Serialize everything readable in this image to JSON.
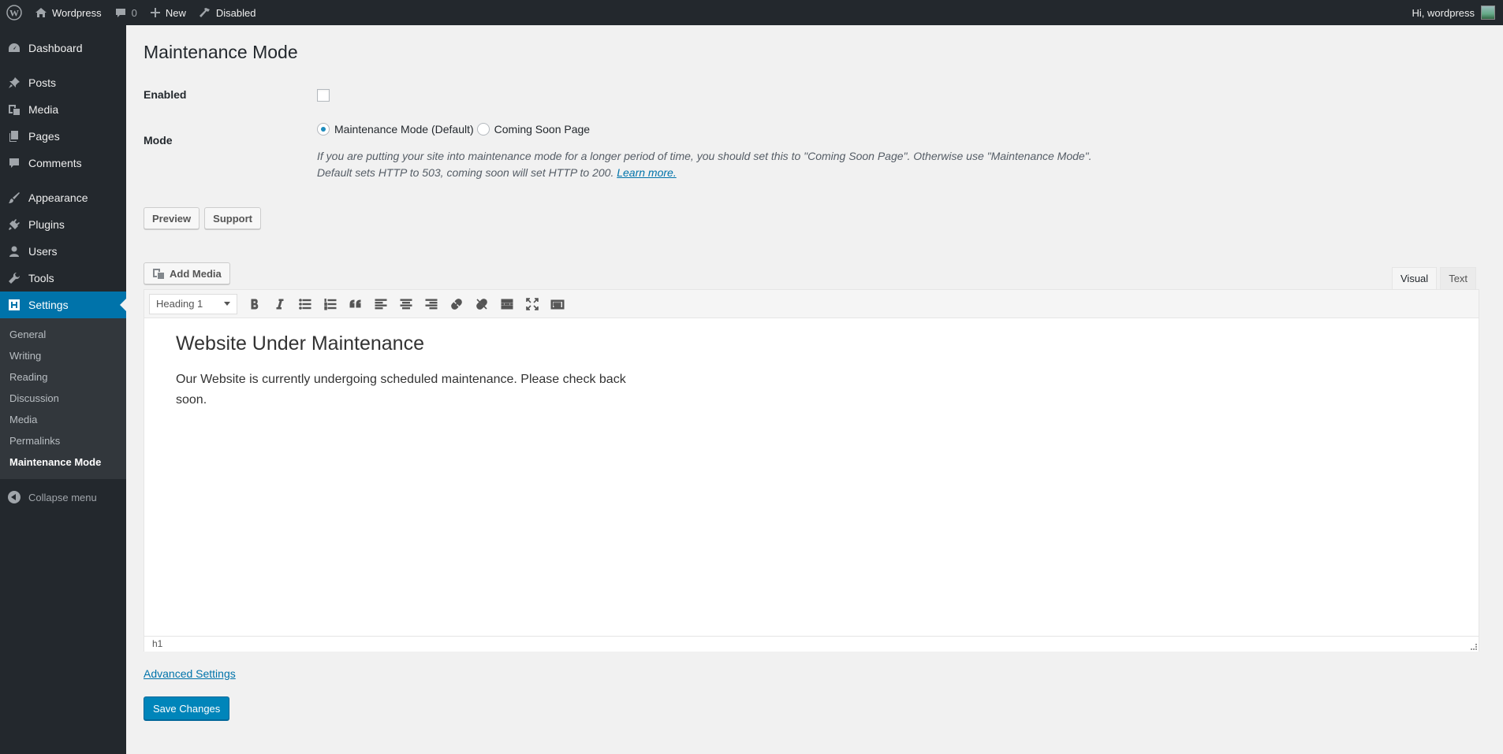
{
  "adminbar": {
    "site_name": "Wordpress",
    "comments_count": "0",
    "new_label": "New",
    "status_label": "Disabled",
    "greeting": "Hi, wordpress"
  },
  "sidebar": {
    "items": [
      {
        "label": "Dashboard",
        "icon": "dashboard-icon"
      },
      {
        "label": "Posts",
        "icon": "pin-icon"
      },
      {
        "label": "Media",
        "icon": "media-icon"
      },
      {
        "label": "Pages",
        "icon": "pages-icon"
      },
      {
        "label": "Comments",
        "icon": "comment-icon"
      },
      {
        "label": "Appearance",
        "icon": "brush-icon"
      },
      {
        "label": "Plugins",
        "icon": "plug-icon"
      },
      {
        "label": "Users",
        "icon": "user-icon"
      },
      {
        "label": "Tools",
        "icon": "wrench-icon"
      },
      {
        "label": "Settings",
        "icon": "settings-icon"
      }
    ],
    "submenu": [
      "General",
      "Writing",
      "Reading",
      "Discussion",
      "Media",
      "Permalinks",
      "Maintenance Mode"
    ],
    "collapse_label": "Collapse menu"
  },
  "page": {
    "title": "Maintenance Mode",
    "enabled_label": "Enabled",
    "enabled_checked": false,
    "mode_label": "Mode",
    "mode_options": [
      "Maintenance Mode (Default)",
      "Coming Soon Page"
    ],
    "mode_selected": "Maintenance Mode (Default)",
    "description_line1": "If you are putting your site into maintenance mode for a longer period of time, you should set this to \"Coming Soon Page\". Otherwise use \"Maintenance Mode\".",
    "description_line2": "Default sets HTTP to 503, coming soon will set HTTP to 200.",
    "learn_more": "Learn more.",
    "preview_button": "Preview",
    "support_button": "Support"
  },
  "editor": {
    "add_media": "Add Media",
    "tab_visual": "Visual",
    "tab_text": "Text",
    "format": "Heading 1",
    "heading": "Website Under Maintenance",
    "body": "Our Website is currently undergoing scheduled maintenance. Please check back soon.",
    "path": "h1"
  },
  "footer": {
    "advanced_settings": "Advanced Settings",
    "save_button": "Save Changes"
  },
  "colors": {
    "accent": "#0073aa",
    "primary_button": "#0085ba",
    "sidebar_bg": "#23282d"
  }
}
